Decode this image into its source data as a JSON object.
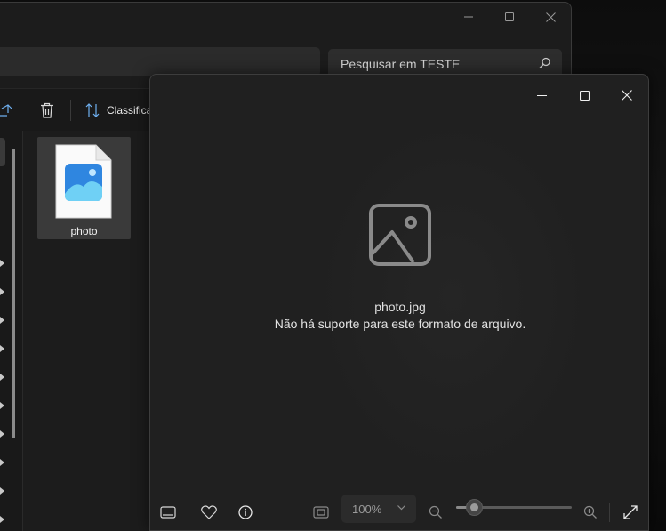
{
  "explorer": {
    "search_placeholder": "Pesquisar em TESTE",
    "toolbar": {
      "sort_label": "Classificar"
    },
    "file": {
      "name": "photo"
    }
  },
  "viewer": {
    "filename": "photo.jpg",
    "message": "Não há suporte para este formato de arquivo.",
    "zoom_level": "100%",
    "zoom_slider_fraction": 0.15
  },
  "colors": {
    "window_bg": "#202020",
    "explorer_bg": "#1c1c1c",
    "file_icon_accent": "#3b8ee8"
  }
}
